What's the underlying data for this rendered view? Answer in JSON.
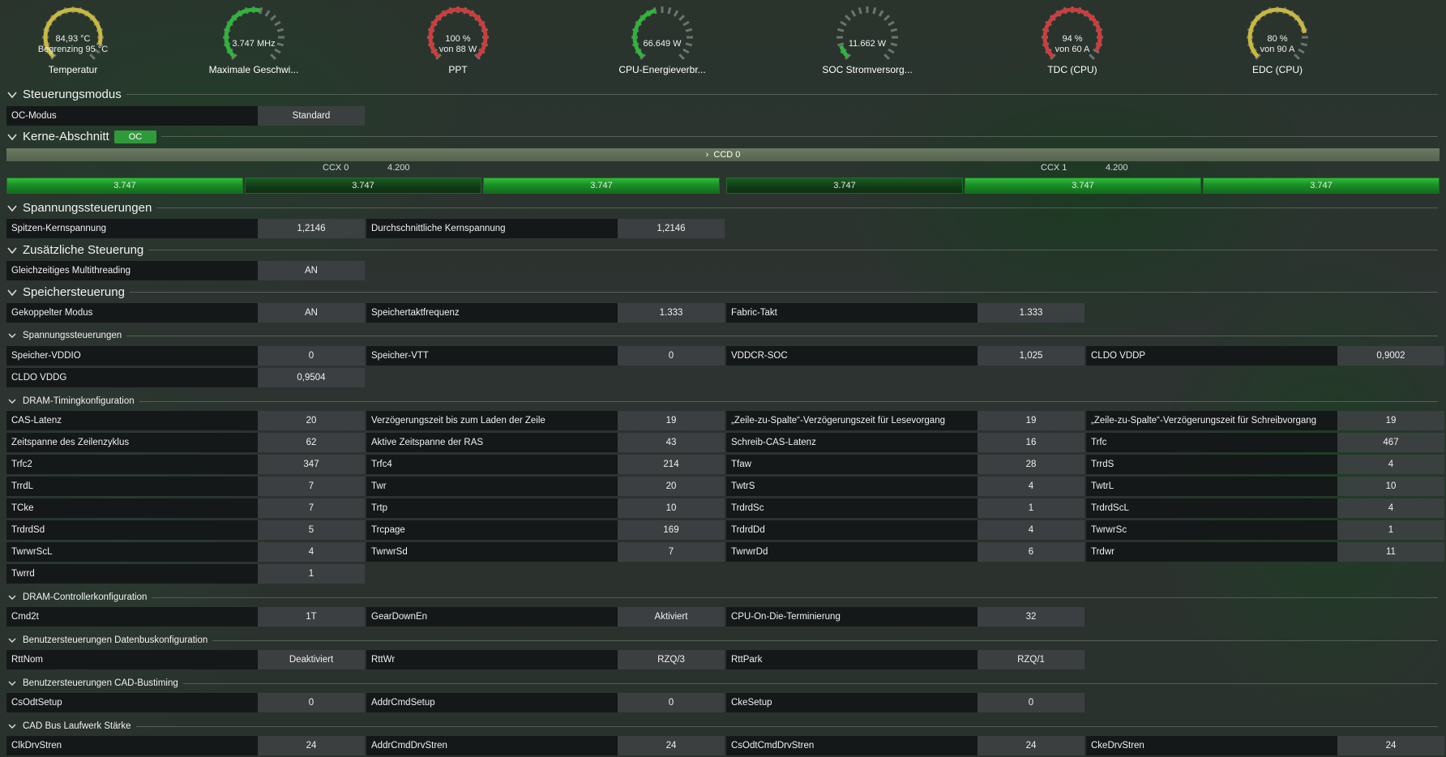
{
  "gauges": [
    {
      "value": "84,93 °C",
      "sub": "Begrenzing 95 °C",
      "label": "Temperatur",
      "color": "#c9b840",
      "fraction": 0.89
    },
    {
      "value": "3.747  MHz",
      "sub": "",
      "label": "Maximale Geschwi...",
      "color": "#2fb53a",
      "fraction": 0.55
    },
    {
      "value": "100 %",
      "sub": "von 88 W",
      "label": "PPT",
      "color": "#d23b3b",
      "fraction": 1.0
    },
    {
      "value": "66.649 W",
      "sub": "",
      "label": "CPU-Energieverbr...",
      "color": "#2fb53a",
      "fraction": 0.45
    },
    {
      "value": "11.662 W",
      "sub": "",
      "label": "SOC Stromversorg...",
      "color": "#2fb53a",
      "fraction": 0.1
    },
    {
      "value": "94 %",
      "sub": "von 60 A",
      "label": "TDC (CPU)",
      "color": "#d23b3b",
      "fraction": 0.94
    },
    {
      "value": "80 %",
      "sub": "von 90 A",
      "label": "EDC (CPU)",
      "color": "#c9b840",
      "fraction": 0.8
    }
  ],
  "sections": {
    "steuerungsmodus": "Steuerungsmodus",
    "kerne": "Kerne-Abschnitt",
    "kerne_badge": "OC",
    "spannung": "Spannungssteuerungen",
    "zusaetzlich": "Zusätzliche Steuerung",
    "speicher": "Speichersteuerung",
    "speicher_spannung": "Spannungssteuerungen",
    "dram_timing": "DRAM-Timingkonfiguration",
    "dram_ctrl": "DRAM-Controllerkonfiguration",
    "datenbus": "Benutzersteuerungen Datenbuskonfiguration",
    "cad": "Benutzersteuerungen CAD-Bustiming",
    "cadbus": "CAD Bus Laufwerk Stärke"
  },
  "oc_mode": {
    "label": "OC-Modus",
    "value": "Standard"
  },
  "ccd": {
    "name": "CCD 0",
    "ccx0": {
      "name": "CCX 0",
      "max": "4.200",
      "cores": [
        "3.747",
        "3.747",
        "3.747"
      ]
    },
    "ccx1": {
      "name": "CCX 1",
      "max": "4.200",
      "cores": [
        "3.747",
        "3.747",
        "3.747"
      ]
    }
  },
  "voltage": [
    {
      "label": "Spitzen-Kernspannung",
      "value": "1,2146"
    },
    {
      "label": "Durchschnittliche Kernspannung",
      "value": "1,2146"
    }
  ],
  "extra": [
    {
      "label": "Gleichzeitiges Multithreading",
      "value": "AN"
    }
  ],
  "memory": [
    {
      "label": "Gekoppelter Modus",
      "value": "AN"
    },
    {
      "label": "Speichertaktfrequenz",
      "value": "1.333"
    },
    {
      "label": "Fabric-Takt",
      "value": "1.333"
    }
  ],
  "mem_voltage": [
    {
      "label": "Speicher-VDDIO",
      "value": "0"
    },
    {
      "label": "Speicher-VTT",
      "value": "0"
    },
    {
      "label": "VDDCR-SOC",
      "value": "1,025"
    },
    {
      "label": "CLDO VDDP",
      "value": "0,9002"
    },
    {
      "label": "CLDO VDDG",
      "value": "0,9504"
    }
  ],
  "timing": [
    {
      "label": "CAS-Latenz",
      "value": "20"
    },
    {
      "label": "Verzögerungszeit bis zum Laden der Zeile",
      "value": "19"
    },
    {
      "label": "„Zeile-zu-Spalte“-Verzögerungszeit für Lesevorgang",
      "value": "19"
    },
    {
      "label": "„Zeile-zu-Spalte“-Verzögerungszeit für Schreibvorgang",
      "value": "19"
    },
    {
      "label": "Zeitspanne des Zeilenzyklus",
      "value": "62"
    },
    {
      "label": "Aktive Zeitspanne der RAS",
      "value": "43"
    },
    {
      "label": "Schreib-CAS-Latenz",
      "value": "16"
    },
    {
      "label": "Trfc",
      "value": "467"
    },
    {
      "label": "Trfc2",
      "value": "347"
    },
    {
      "label": "Trfc4",
      "value": "214"
    },
    {
      "label": "Tfaw",
      "value": "28"
    },
    {
      "label": "TrrdS",
      "value": "4"
    },
    {
      "label": "TrrdL",
      "value": "7"
    },
    {
      "label": "Twr",
      "value": "20"
    },
    {
      "label": "TwtrS",
      "value": "4"
    },
    {
      "label": "TwtrL",
      "value": "10"
    },
    {
      "label": "TCke",
      "value": "7"
    },
    {
      "label": "Trtp",
      "value": "10"
    },
    {
      "label": "TrdrdSc",
      "value": "1"
    },
    {
      "label": "TrdrdScL",
      "value": "4"
    },
    {
      "label": "TrdrdSd",
      "value": "5"
    },
    {
      "label": "Trcpage",
      "value": "169"
    },
    {
      "label": "TrdrdDd",
      "value": "4"
    },
    {
      "label": "TwrwrSc",
      "value": "1"
    },
    {
      "label": "TwrwrScL",
      "value": "4"
    },
    {
      "label": "TwrwrSd",
      "value": "7"
    },
    {
      "label": "TwrwrDd",
      "value": "6"
    },
    {
      "label": "Trdwr",
      "value": "11"
    },
    {
      "label": "Twrrd",
      "value": "1"
    }
  ],
  "controller": [
    {
      "label": "Cmd2t",
      "value": "1T"
    },
    {
      "label": "GearDownEn",
      "value": "Aktiviert"
    },
    {
      "label": "CPU-On-Die-Terminierung",
      "value": "32"
    }
  ],
  "databus": [
    {
      "label": "RttNom",
      "value": "Deaktiviert"
    },
    {
      "label": "RttWr",
      "value": "RZQ/3"
    },
    {
      "label": "RttPark",
      "value": "RZQ/1"
    }
  ],
  "cadtiming": [
    {
      "label": "CsOdtSetup",
      "value": "0"
    },
    {
      "label": "AddrCmdSetup",
      "value": "0"
    },
    {
      "label": "CkeSetup",
      "value": "0"
    }
  ],
  "cadstrength": [
    {
      "label": "ClkDrvStren",
      "value": "24"
    },
    {
      "label": "AddrCmdDrvStren",
      "value": "24"
    },
    {
      "label": "CsOdtCmdDrvStren",
      "value": "24"
    },
    {
      "label": "CkeDrvStren",
      "value": "24"
    }
  ]
}
